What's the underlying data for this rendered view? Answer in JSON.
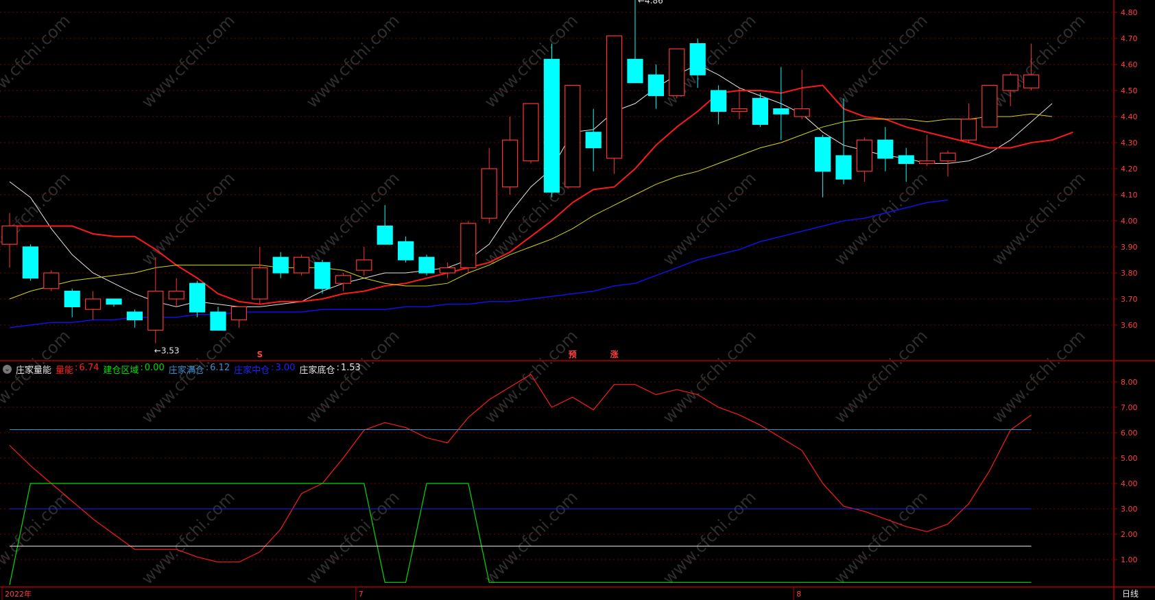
{
  "colors": {
    "up": "#ff3232",
    "down": "#00ffff",
    "axis": "#b00000",
    "grid": "#7a0000",
    "ma_white": "#e6e6e6",
    "ma_red": "#ff1a1a",
    "ma_yellow": "#d8d800",
    "ma_blue": "#1010e8",
    "label": "#ff4040",
    "watermark": "#3a3a3a"
  },
  "watermark": "www.cfchi.com",
  "price_panel": {
    "y_ticks": [
      "4.80",
      "4.70",
      "4.60",
      "4.50",
      "4.40",
      "4.30",
      "4.20",
      "4.10",
      "4.00",
      "3.90",
      "3.80",
      "3.70",
      "3.60"
    ],
    "high_annotation": "4.86",
    "low_annotation": "3.53",
    "signal_markers": [
      {
        "label": "S",
        "bar": 12
      },
      {
        "label": "预",
        "bar": 27
      },
      {
        "label": "涨",
        "bar": 29
      }
    ]
  },
  "indicator_panel": {
    "name": "庄家量能",
    "legend": [
      {
        "label": "量能",
        "value": "6.74",
        "color": "#ff2020"
      },
      {
        "label": "建仓区域",
        "value": "0.00",
        "color": "#00dd00"
      },
      {
        "label": "庄家满仓",
        "value": "6.12",
        "color": "#3a8fd0"
      },
      {
        "label": "庄家中仓",
        "value": "3.00",
        "color": "#2020ff"
      },
      {
        "label": "庄家底仓",
        "value": "1.53",
        "color": "#e8e8e8"
      }
    ],
    "y_ticks": [
      "8.00",
      "7.00",
      "6.00",
      "5.00",
      "4.00",
      "3.00",
      "2.00",
      "1.00"
    ]
  },
  "time_axis": {
    "labels": [
      {
        "text": "2022年",
        "bar": 0
      },
      {
        "text": "7",
        "bar": 17
      },
      {
        "text": "8",
        "bar": 38
      }
    ],
    "period_label": "日线"
  },
  "chart_data": [
    {
      "type": "candlestick",
      "ylim": [
        3.53,
        4.86
      ],
      "bars": [
        {
          "o": 3.91,
          "h": 4.03,
          "l": 3.82,
          "c": 3.98
        },
        {
          "o": 3.9,
          "h": 3.91,
          "l": 3.77,
          "c": 3.78
        },
        {
          "o": 3.74,
          "h": 3.81,
          "l": 3.73,
          "c": 3.8
        },
        {
          "o": 3.73,
          "h": 3.74,
          "l": 3.63,
          "c": 3.67
        },
        {
          "o": 3.66,
          "h": 3.73,
          "l": 3.62,
          "c": 3.7
        },
        {
          "o": 3.7,
          "h": 3.7,
          "l": 3.67,
          "c": 3.68
        },
        {
          "o": 3.65,
          "h": 3.66,
          "l": 3.59,
          "c": 3.62
        },
        {
          "o": 3.58,
          "h": 3.86,
          "l": 3.53,
          "c": 3.73
        },
        {
          "o": 3.7,
          "h": 3.78,
          "l": 3.67,
          "c": 3.73
        },
        {
          "o": 3.76,
          "h": 3.77,
          "l": 3.63,
          "c": 3.65
        },
        {
          "o": 3.65,
          "h": 3.67,
          "l": 3.58,
          "c": 3.58
        },
        {
          "o": 3.62,
          "h": 3.67,
          "l": 3.59,
          "c": 3.67
        },
        {
          "o": 3.7,
          "h": 3.9,
          "l": 3.68,
          "c": 3.82
        },
        {
          "o": 3.86,
          "h": 3.88,
          "l": 3.78,
          "c": 3.8
        },
        {
          "o": 3.8,
          "h": 3.87,
          "l": 3.79,
          "c": 3.86
        },
        {
          "o": 3.84,
          "h": 3.85,
          "l": 3.72,
          "c": 3.74
        },
        {
          "o": 3.76,
          "h": 3.8,
          "l": 3.73,
          "c": 3.79
        },
        {
          "o": 3.81,
          "h": 3.9,
          "l": 3.79,
          "c": 3.85
        },
        {
          "o": 3.98,
          "h": 4.06,
          "l": 3.91,
          "c": 3.91
        },
        {
          "o": 3.92,
          "h": 3.94,
          "l": 3.84,
          "c": 3.85
        },
        {
          "o": 3.86,
          "h": 3.87,
          "l": 3.79,
          "c": 3.8
        },
        {
          "o": 3.8,
          "h": 3.84,
          "l": 3.78,
          "c": 3.82
        },
        {
          "o": 3.82,
          "h": 4.0,
          "l": 3.8,
          "c": 3.99
        },
        {
          "o": 4.01,
          "h": 4.28,
          "l": 3.99,
          "c": 4.2
        },
        {
          "o": 4.13,
          "h": 4.4,
          "l": 4.1,
          "c": 4.31
        },
        {
          "o": 4.23,
          "h": 4.45,
          "l": 4.22,
          "c": 4.45
        },
        {
          "o": 4.62,
          "h": 4.68,
          "l": 4.09,
          "c": 4.11
        },
        {
          "o": 4.13,
          "h": 4.52,
          "l": 4.13,
          "c": 4.52
        },
        {
          "o": 4.34,
          "h": 4.43,
          "l": 4.19,
          "c": 4.28
        },
        {
          "o": 4.24,
          "h": 4.71,
          "l": 4.18,
          "c": 4.71
        },
        {
          "o": 4.62,
          "h": 4.86,
          "l": 4.53,
          "c": 4.53
        },
        {
          "o": 4.56,
          "h": 4.6,
          "l": 4.43,
          "c": 4.48
        },
        {
          "o": 4.48,
          "h": 4.66,
          "l": 4.47,
          "c": 4.66
        },
        {
          "o": 4.68,
          "h": 4.7,
          "l": 4.51,
          "c": 4.56
        },
        {
          "o": 4.5,
          "h": 4.52,
          "l": 4.37,
          "c": 4.42
        },
        {
          "o": 4.42,
          "h": 4.51,
          "l": 4.39,
          "c": 4.43
        },
        {
          "o": 4.47,
          "h": 4.49,
          "l": 4.36,
          "c": 4.37
        },
        {
          "o": 4.43,
          "h": 4.59,
          "l": 4.31,
          "c": 4.41
        },
        {
          "o": 4.4,
          "h": 4.58,
          "l": 4.39,
          "c": 4.43
        },
        {
          "o": 4.32,
          "h": 4.33,
          "l": 4.09,
          "c": 4.19
        },
        {
          "o": 4.25,
          "h": 4.47,
          "l": 4.14,
          "c": 4.16
        },
        {
          "o": 4.19,
          "h": 4.32,
          "l": 4.15,
          "c": 4.31
        },
        {
          "o": 4.31,
          "h": 4.36,
          "l": 4.19,
          "c": 4.24
        },
        {
          "o": 4.25,
          "h": 4.28,
          "l": 4.15,
          "c": 4.22
        },
        {
          "o": 4.22,
          "h": 4.33,
          "l": 4.21,
          "c": 4.23
        },
        {
          "o": 4.23,
          "h": 4.27,
          "l": 4.17,
          "c": 4.26
        },
        {
          "o": 4.31,
          "h": 4.45,
          "l": 4.3,
          "c": 4.39
        },
        {
          "o": 4.36,
          "h": 4.52,
          "l": 4.36,
          "c": 4.52
        },
        {
          "o": 4.5,
          "h": 4.57,
          "l": 4.44,
          "c": 4.56
        },
        {
          "o": 4.51,
          "h": 4.68,
          "l": 4.5,
          "c": 4.56
        }
      ],
      "series": [
        {
          "color_key": "ma_white",
          "width": 1,
          "values": [
            4.15,
            4.09,
            3.97,
            3.87,
            3.8,
            3.76,
            3.72,
            3.69,
            3.67,
            3.69,
            3.68,
            3.67,
            3.67,
            3.68,
            3.69,
            3.73,
            3.76,
            3.78,
            3.8,
            3.8,
            3.81,
            3.82,
            3.85,
            3.91,
            4.03,
            4.13,
            4.2,
            4.34,
            4.35,
            4.42,
            4.45,
            4.51,
            4.56,
            4.6,
            4.56,
            4.51,
            4.48,
            4.45,
            4.41,
            4.34,
            4.29,
            4.27,
            4.25,
            4.24,
            4.22,
            4.22,
            4.23,
            4.26,
            4.31,
            4.38,
            4.45
          ]
        },
        {
          "color_key": "ma_red",
          "width": 2,
          "values": [
            3.98,
            3.98,
            3.98,
            3.98,
            3.95,
            3.94,
            3.94,
            3.89,
            3.83,
            3.78,
            3.72,
            3.69,
            3.68,
            3.69,
            3.69,
            3.7,
            3.72,
            3.73,
            3.75,
            3.76,
            3.78,
            3.8,
            3.82,
            3.84,
            3.88,
            3.94,
            4.0,
            4.07,
            4.12,
            4.13,
            4.2,
            4.29,
            4.36,
            4.42,
            4.49,
            4.5,
            4.5,
            4.49,
            4.51,
            4.52,
            4.43,
            4.4,
            4.39,
            4.36,
            4.34,
            4.32,
            4.3,
            4.28,
            4.28,
            4.3,
            4.31,
            4.34
          ]
        },
        {
          "color_key": "ma_yellow",
          "width": 1,
          "values": [
            3.7,
            3.73,
            3.75,
            3.77,
            3.78,
            3.79,
            3.8,
            3.82,
            3.83,
            3.83,
            3.83,
            3.83,
            3.83,
            3.82,
            3.82,
            3.82,
            3.81,
            3.78,
            3.76,
            3.75,
            3.75,
            3.76,
            3.8,
            3.83,
            3.87,
            3.9,
            3.93,
            3.97,
            4.02,
            4.06,
            4.1,
            4.14,
            4.17,
            4.19,
            4.22,
            4.25,
            4.28,
            4.3,
            4.33,
            4.36,
            4.38,
            4.39,
            4.39,
            4.39,
            4.38,
            4.39,
            4.39,
            4.4,
            4.4,
            4.41,
            4.4
          ]
        },
        {
          "color_key": "ma_blue",
          "width": 1.5,
          "values": [
            3.59,
            3.6,
            3.61,
            3.61,
            3.62,
            3.62,
            3.63,
            3.63,
            3.63,
            3.64,
            3.64,
            3.65,
            3.65,
            3.65,
            3.65,
            3.66,
            3.66,
            3.66,
            3.66,
            3.67,
            3.67,
            3.68,
            3.68,
            3.69,
            3.69,
            3.7,
            3.71,
            3.72,
            3.73,
            3.75,
            3.76,
            3.79,
            3.82,
            3.85,
            3.87,
            3.89,
            3.92,
            3.94,
            3.96,
            3.98,
            4.0,
            4.01,
            4.03,
            4.05,
            4.07,
            4.08
          ]
        }
      ]
    },
    {
      "type": "line",
      "ylim": [
        0,
        8.6
      ],
      "series": [
        {
          "name": "量能",
          "color_key": "ma_red",
          "values": [
            5.5,
            4.7,
            4.0,
            3.3,
            2.6,
            2.0,
            1.4,
            1.4,
            1.4,
            1.1,
            0.9,
            0.9,
            1.3,
            2.2,
            3.6,
            4.0,
            5.0,
            6.1,
            6.4,
            6.2,
            5.8,
            5.6,
            6.6,
            7.3,
            7.8,
            8.3,
            7.0,
            7.4,
            6.9,
            7.9,
            7.9,
            7.5,
            7.7,
            7.5,
            7.0,
            6.7,
            6.3,
            5.8,
            5.3,
            4.0,
            3.1,
            2.9,
            2.6,
            2.3,
            2.1,
            2.4,
            3.2,
            4.5,
            6.1,
            6.7
          ]
        },
        {
          "name": "建仓区域",
          "color": "#00dd00",
          "x": [
            0,
            1,
            2,
            3,
            4,
            5,
            6,
            7,
            8,
            9,
            10,
            11,
            12,
            13,
            14,
            15,
            16,
            17,
            18,
            19,
            20,
            21,
            22,
            23,
            24,
            25,
            26,
            27,
            28,
            29,
            30,
            31,
            32,
            33,
            34,
            35,
            36,
            37,
            38,
            39,
            40,
            41,
            42,
            43,
            44,
            45,
            46,
            47,
            48,
            49
          ],
          "values": [
            0,
            4.0,
            4.0,
            4.0,
            4.0,
            4.0,
            4.0,
            4.0,
            4.0,
            4.0,
            4.0,
            4.0,
            4.0,
            4.0,
            4.0,
            4.0,
            4.0,
            4.0,
            0.1,
            0.1,
            4.0,
            4.0,
            4.0,
            0.1,
            0.1,
            0.1,
            0.1,
            0.1,
            0.1,
            0.1,
            0.1,
            0.1,
            0.1,
            0.1,
            0.1,
            0.1,
            0.1,
            0.1,
            0.1,
            0.1,
            0.1,
            0.1,
            0.1,
            0.1,
            0.1,
            0.1,
            0.1,
            0.1,
            0.1,
            0.1
          ]
        },
        {
          "name": "庄家满仓",
          "color": "#3a8fd0",
          "constant": 6.12
        },
        {
          "name": "庄家中仓",
          "color": "#2020ff",
          "constant": 3.0
        },
        {
          "name": "庄家底仓",
          "color": "#e8e8e8",
          "constant": 1.53
        }
      ]
    }
  ]
}
